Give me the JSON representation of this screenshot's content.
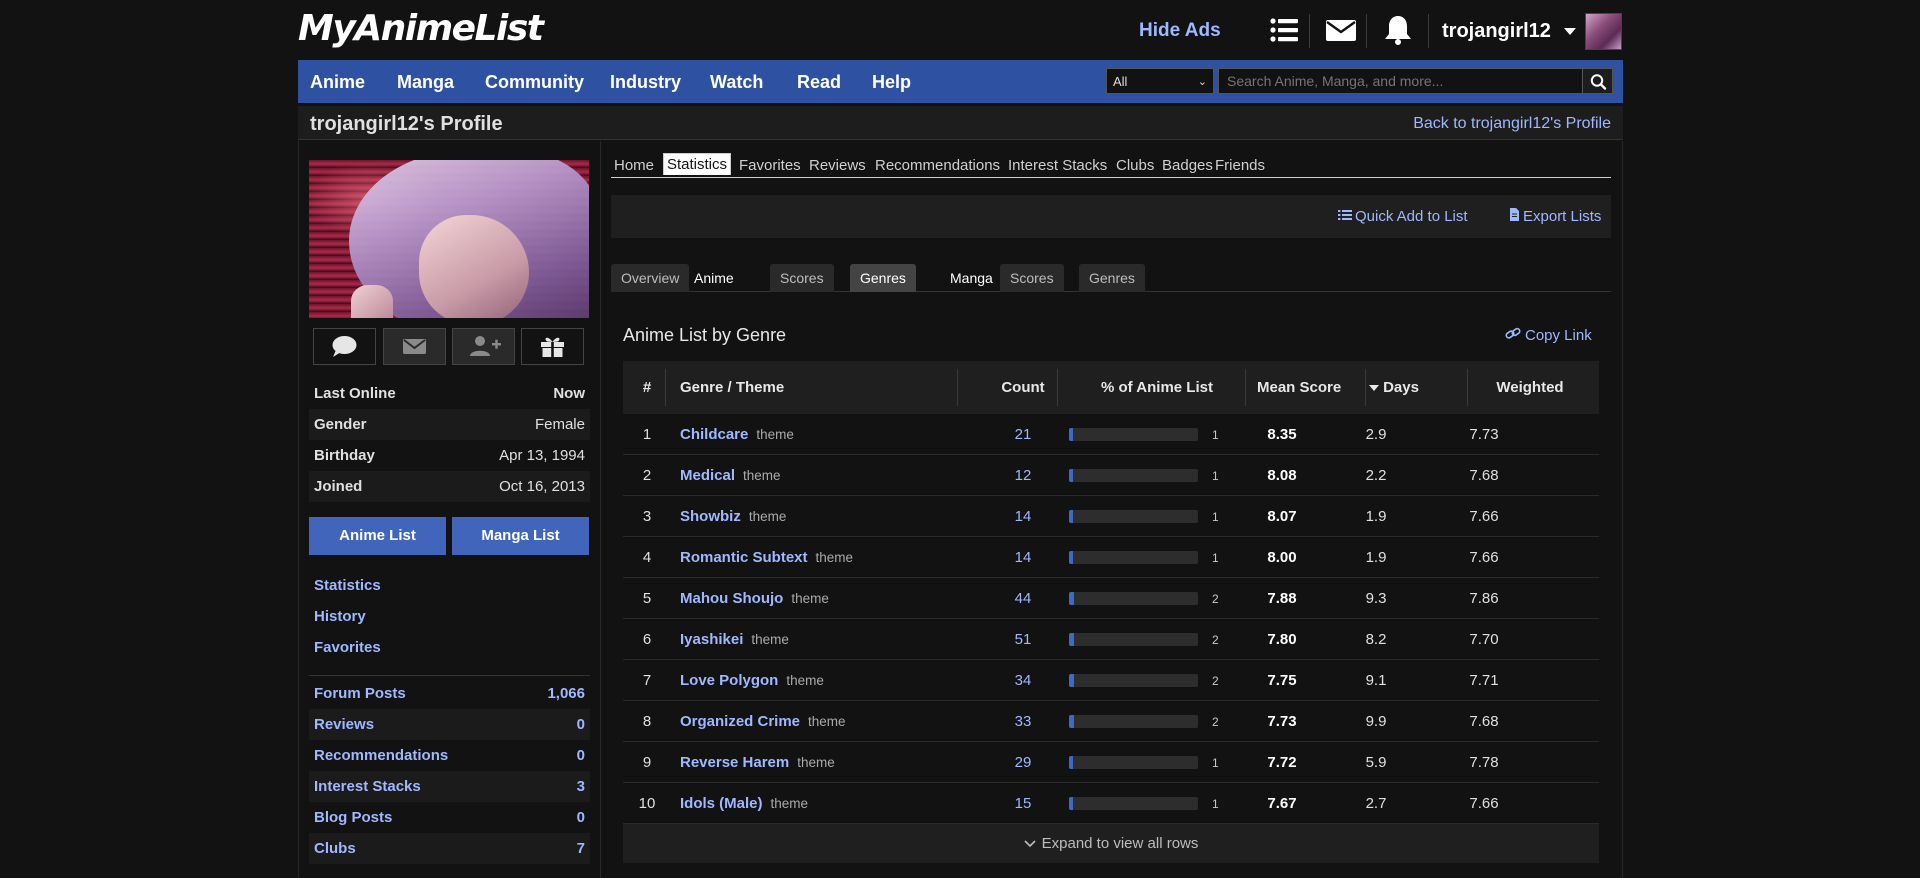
{
  "header": {
    "logo": "MyAnimeList",
    "hide_ads": "Hide Ads",
    "username": "trojangirl12",
    "icons": [
      "list-icon",
      "mail-icon",
      "bell-icon"
    ]
  },
  "nav": {
    "items": [
      "Anime",
      "Manga",
      "Community",
      "Industry",
      "Watch",
      "Read",
      "Help"
    ],
    "search_filter": "All",
    "search_placeholder": "Search Anime, Manga, and more..."
  },
  "title_bar": {
    "title": "trojangirl12's Profile",
    "back_link": "Back to trojangirl12's Profile"
  },
  "sidebar": {
    "info": [
      {
        "label": "Last Online",
        "value": "Now"
      },
      {
        "label": "Gender",
        "value": "Female"
      },
      {
        "label": "Birthday",
        "value": "Apr 13, 1994"
      },
      {
        "label": "Joined",
        "value": "Oct 16, 2013"
      }
    ],
    "anime_list_button": "Anime List",
    "manga_list_button": "Manga List",
    "links": [
      "Statistics",
      "History",
      "Favorites"
    ],
    "counts": [
      {
        "label": "Forum Posts",
        "value": "1,066"
      },
      {
        "label": "Reviews",
        "value": "0"
      },
      {
        "label": "Recommendations",
        "value": "0"
      },
      {
        "label": "Interest Stacks",
        "value": "3"
      },
      {
        "label": "Blog Posts",
        "value": "0"
      },
      {
        "label": "Clubs",
        "value": "7"
      }
    ]
  },
  "profile_tabs": {
    "items": [
      "Home",
      "Statistics",
      "Favorites",
      "Reviews",
      "Recommendations",
      "Interest Stacks",
      "Clubs",
      "Badges",
      "Friends"
    ],
    "active": "Statistics"
  },
  "toolbar": {
    "quick_add": "Quick Add to List",
    "export": "Export Lists"
  },
  "stat_tabs": {
    "items": [
      "Overview",
      "Anime",
      "Scores",
      "Genres",
      "Manga",
      "Scores",
      "Genres"
    ],
    "active_index": 3
  },
  "section": {
    "title": "Anime List by Genre",
    "copy_link": "Copy Link"
  },
  "table": {
    "headers": {
      "rank": "#",
      "genre": "Genre / Theme",
      "count": "Count",
      "percent": "% of Anime List",
      "mean": "Mean Score",
      "days": "Days",
      "weighted": "Weighted"
    },
    "rows": [
      {
        "rank": "1",
        "name": "Childcare",
        "type": "theme",
        "count": "21",
        "pct": "1",
        "pct_value": 1,
        "mean": "8.35",
        "days": "2.9",
        "weighted": "7.73"
      },
      {
        "rank": "2",
        "name": "Medical",
        "type": "theme",
        "count": "12",
        "pct": "1",
        "pct_value": 1,
        "mean": "8.08",
        "days": "2.2",
        "weighted": "7.68"
      },
      {
        "rank": "3",
        "name": "Showbiz",
        "type": "theme",
        "count": "14",
        "pct": "1",
        "pct_value": 1,
        "mean": "8.07",
        "days": "1.9",
        "weighted": "7.66"
      },
      {
        "rank": "4",
        "name": "Romantic Subtext",
        "type": "theme",
        "count": "14",
        "pct": "1",
        "pct_value": 1,
        "mean": "8.00",
        "days": "1.9",
        "weighted": "7.66"
      },
      {
        "rank": "5",
        "name": "Mahou Shoujo",
        "type": "theme",
        "count": "44",
        "pct": "2",
        "pct_value": 2,
        "mean": "7.88",
        "days": "9.3",
        "weighted": "7.86"
      },
      {
        "rank": "6",
        "name": "Iyashikei",
        "type": "theme",
        "count": "51",
        "pct": "2",
        "pct_value": 2,
        "mean": "7.80",
        "days": "8.2",
        "weighted": "7.70"
      },
      {
        "rank": "7",
        "name": "Love Polygon",
        "type": "theme",
        "count": "34",
        "pct": "2",
        "pct_value": 2,
        "mean": "7.75",
        "days": "9.1",
        "weighted": "7.71"
      },
      {
        "rank": "8",
        "name": "Organized Crime",
        "type": "theme",
        "count": "33",
        "pct": "2",
        "pct_value": 2,
        "mean": "7.73",
        "days": "9.9",
        "weighted": "7.68"
      },
      {
        "rank": "9",
        "name": "Reverse Harem",
        "type": "theme",
        "count": "29",
        "pct": "1",
        "pct_value": 1,
        "mean": "7.72",
        "days": "5.9",
        "weighted": "7.78"
      },
      {
        "rank": "10",
        "name": "Idols (Male)",
        "type": "theme",
        "count": "15",
        "pct": "1",
        "pct_value": 1,
        "mean": "7.67",
        "days": "2.7",
        "weighted": "7.66"
      }
    ],
    "expand": "Expand to view all rows"
  },
  "colors": {
    "nav_blue": "#2e51a2",
    "link_blue": "#9fb8ff",
    "button_blue": "#4065ba",
    "bar_fill": "#3d69c7",
    "background": "#121212"
  }
}
